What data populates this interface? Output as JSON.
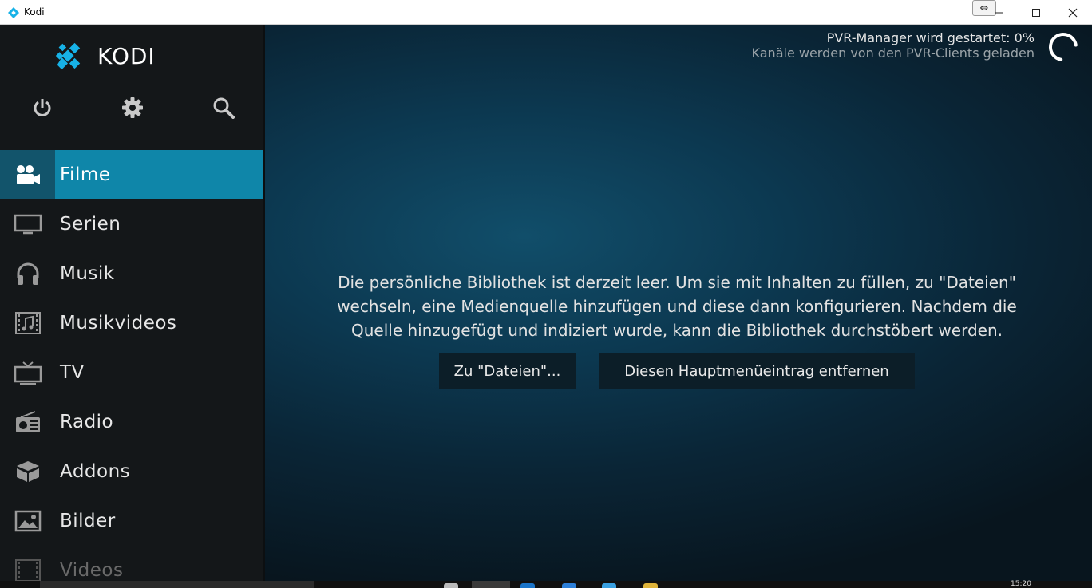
{
  "window": {
    "title": "Kodi"
  },
  "logo": {
    "text": "KODI"
  },
  "top_icons": [
    {
      "name": "power-icon"
    },
    {
      "name": "gear-icon"
    },
    {
      "name": "search-icon"
    }
  ],
  "menu": {
    "items": [
      {
        "label": "Filme",
        "icon": "movie-camera-icon",
        "active": true
      },
      {
        "label": "Serien",
        "icon": "tv-monitor-icon"
      },
      {
        "label": "Musik",
        "icon": "headphones-icon"
      },
      {
        "label": "Musikvideos",
        "icon": "music-video-icon"
      },
      {
        "label": "TV",
        "icon": "tv-icon"
      },
      {
        "label": "Radio",
        "icon": "radio-icon"
      },
      {
        "label": "Addons",
        "icon": "addons-box-icon"
      },
      {
        "label": "Bilder",
        "icon": "picture-icon"
      },
      {
        "label": "Videos",
        "icon": "film-strip-icon"
      }
    ]
  },
  "pvr": {
    "status": "PVR-Manager wird gestartet:  0%",
    "detail": "Kanäle werden von den PVR-Clients geladen"
  },
  "main": {
    "message_lines": [
      "Die persönliche Bibliothek ist derzeit leer. Um sie mit Inhalten zu füllen, zu \"Dateien\"",
      "wechseln, eine Medienquelle hinzufügen und diese dann konfigurieren. Nachdem die",
      "Quelle hinzugefügt und indiziert wurde, kann die Bibliothek durchstöbert werden."
    ],
    "button_files": "Zu \"Dateien\"...",
    "button_remove": "Diesen Hauptmenüeintrag entfernen"
  },
  "taskbar": {
    "clock": "15:20"
  },
  "colors": {
    "accent": "#0f86a9",
    "accent_dark": "#12546b",
    "sidebar": "#141719",
    "button": "#0c1e28"
  }
}
